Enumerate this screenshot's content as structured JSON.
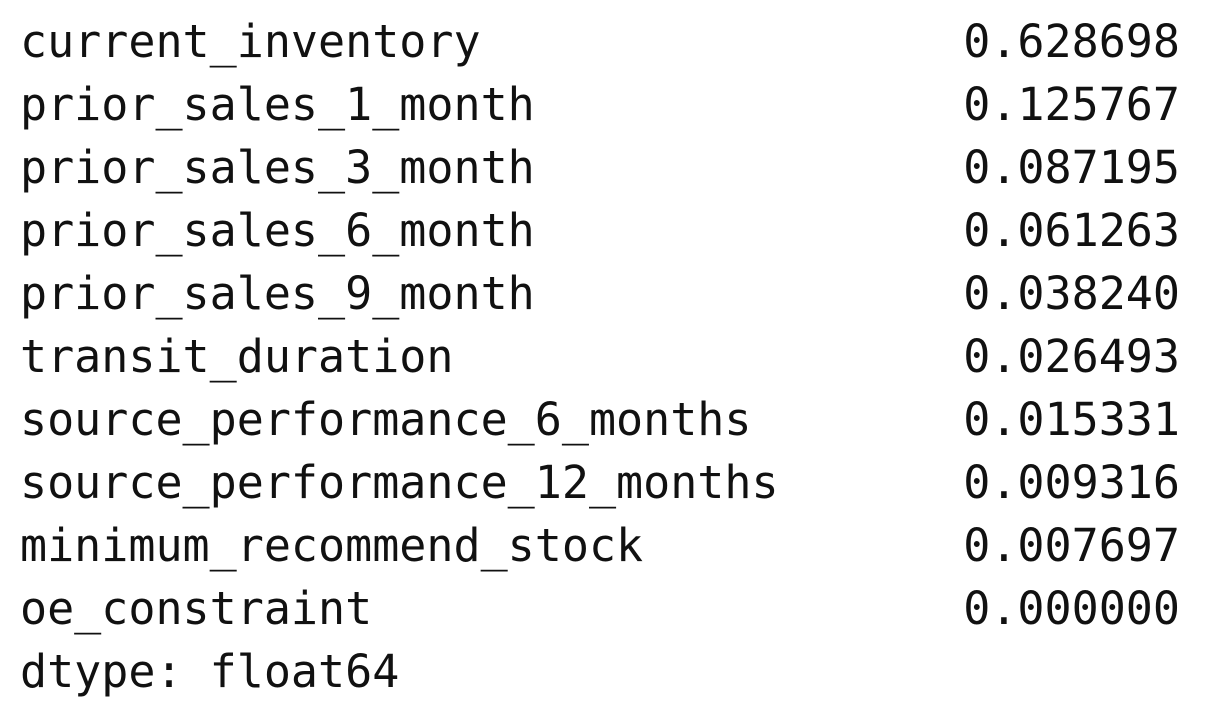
{
  "series": [
    {
      "name": "current_inventory",
      "value": "0.628698"
    },
    {
      "name": "prior_sales_1_month",
      "value": "0.125767"
    },
    {
      "name": "prior_sales_3_month",
      "value": "0.087195"
    },
    {
      "name": "prior_sales_6_month",
      "value": "0.061263"
    },
    {
      "name": "prior_sales_9_month",
      "value": "0.038240"
    },
    {
      "name": "transit_duration",
      "value": "0.026493"
    },
    {
      "name": "source_performance_6_months",
      "value": "0.015331"
    },
    {
      "name": "source_performance_12_months",
      "value": "0.009316"
    },
    {
      "name": "minimum_recommend_stock",
      "value": "0.007697"
    },
    {
      "name": "oe_constraint",
      "value": "0.000000"
    }
  ],
  "dtype_line": "dtype: float64"
}
